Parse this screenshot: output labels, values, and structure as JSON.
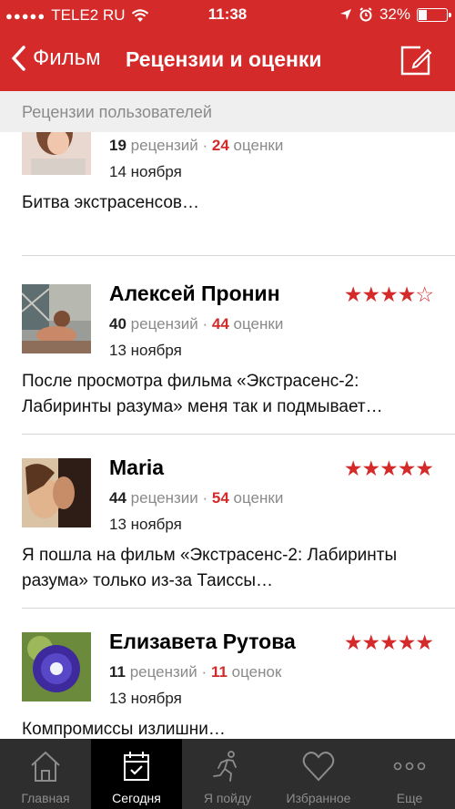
{
  "status": {
    "carrier": "TELE2 RU",
    "time": "11:38",
    "battery": "32%",
    "battery_level": 0.32
  },
  "nav": {
    "back_label": "Фильм",
    "title": "Рецензии и оценки",
    "compose_icon": "compose-icon"
  },
  "section": {
    "title": "Рецензии пользователей"
  },
  "reviews": [
    {
      "name": "",
      "stars": "",
      "reviews_count": "19",
      "reviews_word": "рецензий",
      "dot": "·",
      "ratings_count": "24",
      "ratings_word": "оценки",
      "date": "14 ноября",
      "text": "Битва экстрасенсов…"
    },
    {
      "name": "Алексей Пронин",
      "stars": "★★★★☆",
      "reviews_count": "40",
      "reviews_word": "рецензий",
      "dot": "·",
      "ratings_count": "44",
      "ratings_word": "оценки",
      "date": "13 ноября",
      "text": "После просмотра фильма «Экстрасенс-2: Лабиринты разума» меня так и подмывает…"
    },
    {
      "name": "Maria",
      "stars": "★★★★★",
      "reviews_count": "44",
      "reviews_word": "рецензии",
      "dot": "·",
      "ratings_count": "54",
      "ratings_word": "оценки",
      "date": "13 ноября",
      "text": "Я пошла на фильм «Экстрасенс-2: Лабиринты разума» только из-за Таиссы…"
    },
    {
      "name": "Елизавета Рутова",
      "stars": "★★★★★",
      "reviews_count": "11",
      "reviews_word": "рецензий",
      "dot": "·",
      "ratings_count": "11",
      "ratings_word": "оценок",
      "date": "13 ноября",
      "text": "Компромиссы излишни…"
    }
  ],
  "tabs": [
    {
      "label": "Главная",
      "icon": "home-icon"
    },
    {
      "label": "Сегодня",
      "icon": "calendar-check-icon"
    },
    {
      "label": "Я пойду",
      "icon": "running-man-icon"
    },
    {
      "label": "Избранное",
      "icon": "heart-icon"
    },
    {
      "label": "Еще",
      "icon": "more-dots-icon"
    }
  ]
}
